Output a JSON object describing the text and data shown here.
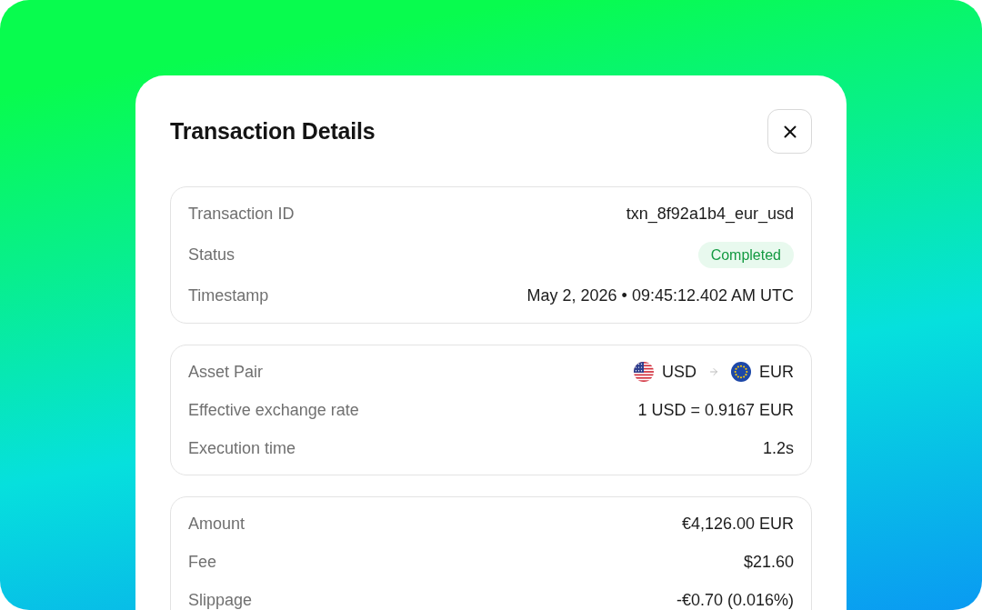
{
  "dialog": {
    "title": "Transaction Details",
    "sections": [
      {
        "rows": [
          {
            "kind": "text",
            "label": "Transaction ID",
            "value": "txn_8f92a1b4_eur_usd"
          },
          {
            "kind": "badge",
            "label": "Status",
            "value": "Completed"
          },
          {
            "kind": "text",
            "label": "Timestamp",
            "value": "May 2, 2026 • 09:45:12.402 AM UTC"
          }
        ]
      },
      {
        "rows": [
          {
            "kind": "pair",
            "label": "Asset Pair",
            "from": "USD",
            "to": "EUR"
          },
          {
            "kind": "text",
            "label": "Effective exchange rate",
            "value": "1 USD = 0.9167 EUR"
          },
          {
            "kind": "text",
            "label": "Execution time",
            "value": "1.2s"
          }
        ]
      },
      {
        "rows": [
          {
            "kind": "text",
            "label": "Amount",
            "value": "€4,126.00 EUR"
          },
          {
            "kind": "text",
            "label": "Fee",
            "value": "$21.60"
          },
          {
            "kind": "text",
            "label": "Slippage",
            "value": "-€0.70 (0.016%)"
          }
        ]
      }
    ]
  }
}
